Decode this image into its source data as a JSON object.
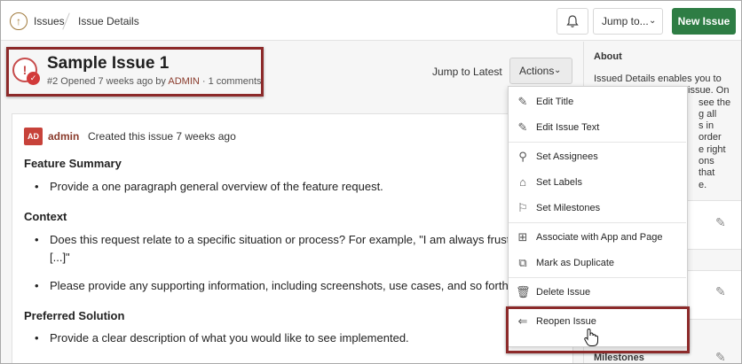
{
  "breadcrumb": {
    "home_icon": "up-arrow-icon",
    "item1": "Issues",
    "item2": "Issue Details"
  },
  "header": {
    "bell_icon": "bell-icon",
    "jump_label": "Jump to...",
    "new_issue_label": "New Issue"
  },
  "issue": {
    "title": "Sample Issue 1",
    "meta_prefix": "#2 Opened 7 weeks ago by ",
    "author": "ADMIN",
    "meta_suffix": " · 1 comments",
    "jump_latest": "Jump to Latest",
    "actions_label": "Actions"
  },
  "post": {
    "avatar": "AD",
    "author": "admin",
    "created": "Created this issue 7 weeks ago",
    "sections": [
      {
        "heading": "Feature Summary",
        "bullets": [
          "Provide a one paragraph general overview of the feature request."
        ]
      },
      {
        "heading": "Context",
        "bullets": [
          "Does this request relate to a specific situation or process? For example, \"I am always frustrat",
          "[...]\"",
          "Please provide any supporting information, including screenshots, use cases, and so forth."
        ]
      },
      {
        "heading": "Preferred Solution",
        "bullets": [
          "Provide a clear description of what you would like to see implemented."
        ]
      }
    ]
  },
  "about": {
    "title": "About",
    "lines": [
      "Issued Details enables you to",
      "issue. On",
      "see the",
      "g all",
      "s in order",
      "e right",
      "ons that",
      "e."
    ]
  },
  "side": {
    "milestones": "Milestones"
  },
  "menu": {
    "items": [
      {
        "label": "Edit Title",
        "icon": "pencil-icon"
      },
      {
        "label": "Edit Issue Text",
        "icon": "pencil-icon"
      },
      {
        "label": "Set Assignees",
        "icon": "user-icon"
      },
      {
        "label": "Set Labels",
        "icon": "tag-icon"
      },
      {
        "label": "Set Milestones",
        "icon": "milestone-icon"
      },
      {
        "label": "Associate with App and Page",
        "icon": "add-app-icon"
      },
      {
        "label": "Mark as Duplicate",
        "icon": "duplicate-icon"
      },
      {
        "label": "Delete Issue",
        "icon": "trash-icon"
      },
      {
        "label": "Reopen Issue",
        "icon": "reopen-icon"
      }
    ]
  },
  "colors": {
    "accent": "#2e7d44",
    "highlight": "#8c2a2a",
    "link": "#8a3b2c",
    "issue_red": "#d23a3a"
  }
}
